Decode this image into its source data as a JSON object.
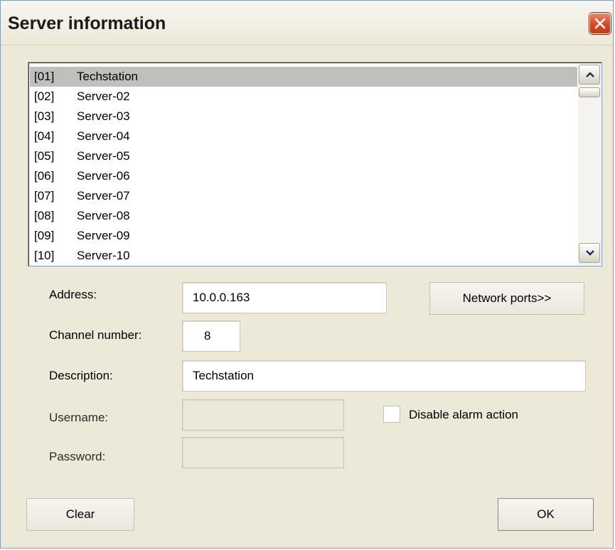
{
  "window": {
    "title": "Server information"
  },
  "servers": [
    {
      "num": "[01]",
      "name": "Techstation"
    },
    {
      "num": "[02]",
      "name": "Server-02"
    },
    {
      "num": "[03]",
      "name": "Server-03"
    },
    {
      "num": "[04]",
      "name": "Server-04"
    },
    {
      "num": "[05]",
      "name": "Server-05"
    },
    {
      "num": "[06]",
      "name": "Server-06"
    },
    {
      "num": "[07]",
      "name": "Server-07"
    },
    {
      "num": "[08]",
      "name": "Server-08"
    },
    {
      "num": "[09]",
      "name": "Server-09"
    },
    {
      "num": "[10]",
      "name": "Server-10"
    }
  ],
  "selected_index": 0,
  "form": {
    "address_label": "Address:",
    "address_value": "10.0.0.163",
    "channel_label": "Channel number:",
    "channel_value": "8",
    "description_label": "Description:",
    "description_value": "Techstation",
    "username_label": "Username:",
    "username_value": "",
    "password_label": "Password:",
    "password_value": "",
    "disable_alarm_label": "Disable alarm action",
    "disable_alarm_checked": false
  },
  "buttons": {
    "network_ports": "Network ports>>",
    "clear": "Clear",
    "ok": "OK"
  },
  "icons": {
    "close": "close-icon",
    "scroll_up": "chevron-up-icon",
    "scroll_down": "chevron-down-icon"
  }
}
